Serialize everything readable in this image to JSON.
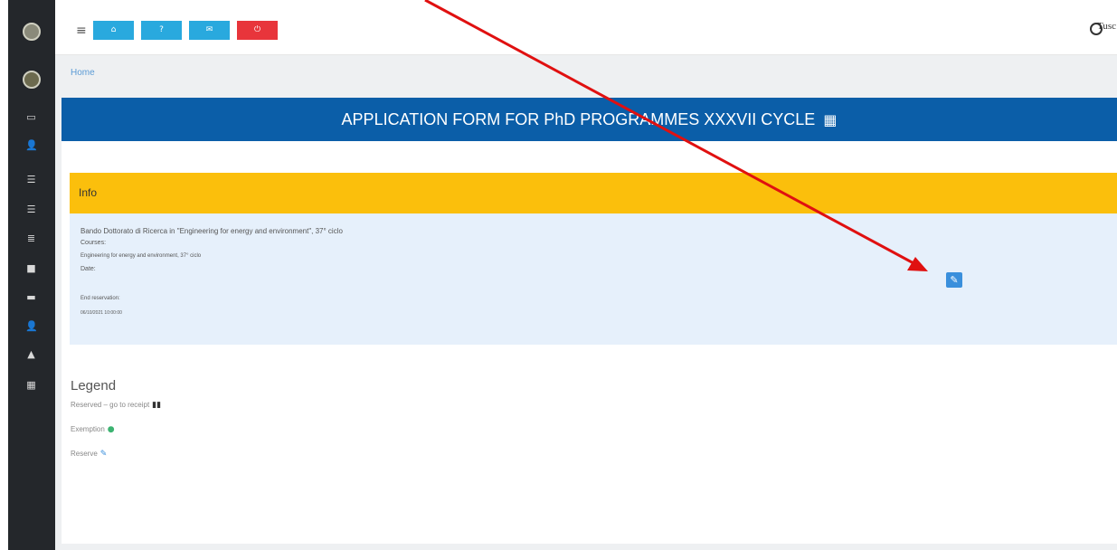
{
  "sidebar": {
    "icons": [
      "card-icon",
      "user-icon",
      "list-icon",
      "list-icon",
      "stack-icon",
      "building-icon",
      "monitor-icon",
      "user-settings-icon",
      "bell-icon",
      "calendar-icon"
    ]
  },
  "toolbar": {
    "menu_glyph": "≡",
    "buttons": [
      {
        "icon": "home-icon",
        "glyph": "⌂",
        "color": "#29a9de"
      },
      {
        "icon": "question-icon",
        "glyph": "?",
        "color": "#29a9de"
      },
      {
        "icon": "mail-icon",
        "glyph": "✉",
        "color": "#29a9de"
      },
      {
        "icon": "logout-icon",
        "glyph": "⏻",
        "color": "#e8353b"
      }
    ],
    "logo_text": "Tusc"
  },
  "breadcrumb": "Home",
  "page_title": "APPLICATION FORM FOR PhD PROGRAMMES XXXVII CYCLE",
  "info": {
    "header": "Info",
    "call_title": "Bando Dottorato di Ricerca in \"Engineering for energy and environment\", 37° ciclo",
    "courses_label": "Courses:",
    "course": "Engineering for energy and environment, 37° ciclo",
    "date_label": "Date:",
    "end_reservation_label": "End reservation:",
    "end_reservation_value": "06/10/2021 10:00:00"
  },
  "legend": {
    "title": "Legend",
    "reserved": "Reserved – go to receipt",
    "exemption": "Exemption",
    "reserve": "Reserve"
  },
  "colors": {
    "header_blue": "#0b5ea8",
    "info_yellow": "#fbbf0c",
    "annotation_red": "#e01010"
  }
}
